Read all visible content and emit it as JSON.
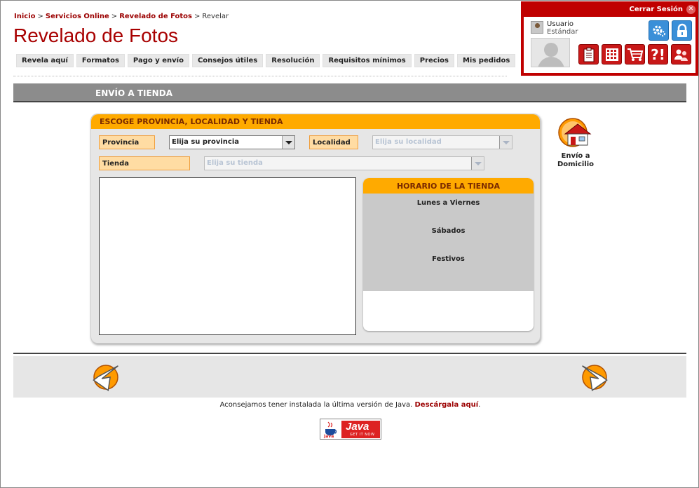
{
  "breadcrumb": {
    "items": [
      "Inicio",
      "Servicios Online",
      "Revelado de Fotos"
    ],
    "current": "Revelar",
    "separator": ">"
  },
  "page_title": "Revelado de Fotos",
  "tabs": [
    "Revela aquí",
    "Formatos",
    "Pago y envío",
    "Consejos útiles",
    "Resolución",
    "Requisitos mínimos",
    "Precios",
    "Mis pedidos"
  ],
  "user_panel": {
    "logout_label": "Cerrar Sesión",
    "logout_icon": "close-icon",
    "user_name": "Usuario",
    "user_level": "Estándar",
    "buttons_top": [
      "settings-icon",
      "lock-icon"
    ],
    "buttons_bottom": [
      "clipboard-icon",
      "calculator-icon",
      "cart-icon",
      "help-icon",
      "users-icon"
    ]
  },
  "section": {
    "title": "ENVÍO A TIENDA"
  },
  "store_box": {
    "title": "ESCOGE PROVINCIA, LOCALIDAD Y TIENDA",
    "provincia_label": "Provincia",
    "provincia_value": "Elija su provincia",
    "localidad_label": "Localidad",
    "localidad_value": "Elija su localidad",
    "tienda_label": "Tienda",
    "tienda_value": "Elija su tienda"
  },
  "hours": {
    "title": "HORARIO DE LA TIENDA",
    "rows": [
      "Lunes a Viernes",
      "Sábados",
      "Festivos"
    ]
  },
  "home_delivery": {
    "line1": "Envío a",
    "line2": "Domicilio"
  },
  "footer": {
    "java_text": "Aconsejamos tener instalada la última versión de Java.",
    "java_link": "Descárgala aquí",
    "java_badge_text": "Java",
    "java_badge_sub": "GET IT NOW"
  },
  "colors": {
    "brand_red": "#a80000",
    "accent_orange": "#ffaa00",
    "panel_grey": "#e6e6e6",
    "bar_grey": "#8c8c8c"
  }
}
